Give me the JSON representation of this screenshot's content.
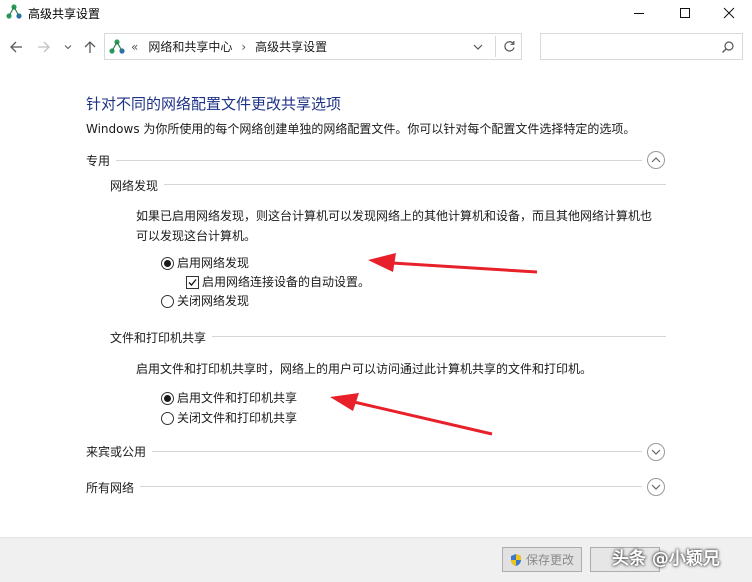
{
  "window": {
    "title": "高级共享设置"
  },
  "nav": {
    "breadcrumb_prefix": "«",
    "breadcrumb_parent": "网络和共享中心",
    "breadcrumb_sep": "›",
    "breadcrumb_current": "高级共享设置",
    "search_placeholder": ""
  },
  "main": {
    "heading": "针对不同的网络配置文件更改共享选项",
    "description": "Windows 为你所使用的每个网络创建单独的网络配置文件。你可以针对每个配置文件选择特定的选项。"
  },
  "sections": {
    "private": {
      "label": "专用"
    },
    "network_discovery": {
      "label": "网络发现",
      "desc_line1": "如果已启用网络发现，则这台计算机可以发现网络上的其他计算机和设备，而且其他网络计算机也",
      "desc_line2": "可以发现这台计算机。",
      "option_on": "启用网络发现",
      "option_auto": "启用网络连接设备的自动设置。",
      "option_off": "关闭网络发现",
      "selected": "on",
      "auto_setup_checked": true
    },
    "file_sharing": {
      "label": "文件和打印机共享",
      "desc": "启用文件和打印机共享时，网络上的用户可以访问通过此计算机共享的文件和打印机。",
      "option_on": "启用文件和打印机共享",
      "option_off": "关闭文件和打印机共享",
      "selected": "on"
    },
    "guest_public": {
      "label": "来宾或公用"
    },
    "all_networks": {
      "label": "所有网络"
    }
  },
  "footer": {
    "save_label": "保存更改",
    "watermark": "头条 @小颖兄"
  },
  "colors": {
    "heading": "#1e3287",
    "annotation_arrow": "#e8202a",
    "footer_bg": "#f0f0f0"
  }
}
